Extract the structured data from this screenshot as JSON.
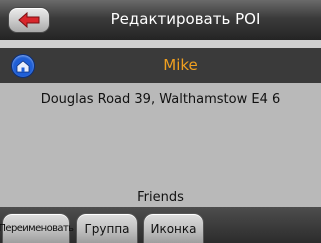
{
  "header": {
    "title": "Редактировать POI"
  },
  "poi": {
    "name": "Mike",
    "address": "Douglas Road 39, Walthamstow E4 6",
    "group": "Friends"
  },
  "tabs": [
    {
      "label": "Переименовать"
    },
    {
      "label": "Группа"
    },
    {
      "label": "Иконка"
    }
  ],
  "icons": {
    "back": "back-arrow-icon",
    "poi": "house-poi-icon"
  },
  "colors": {
    "poi_name": "#f0a020",
    "poi_icon_bg": "#1f5fd6",
    "background": "#b9b9b9"
  }
}
